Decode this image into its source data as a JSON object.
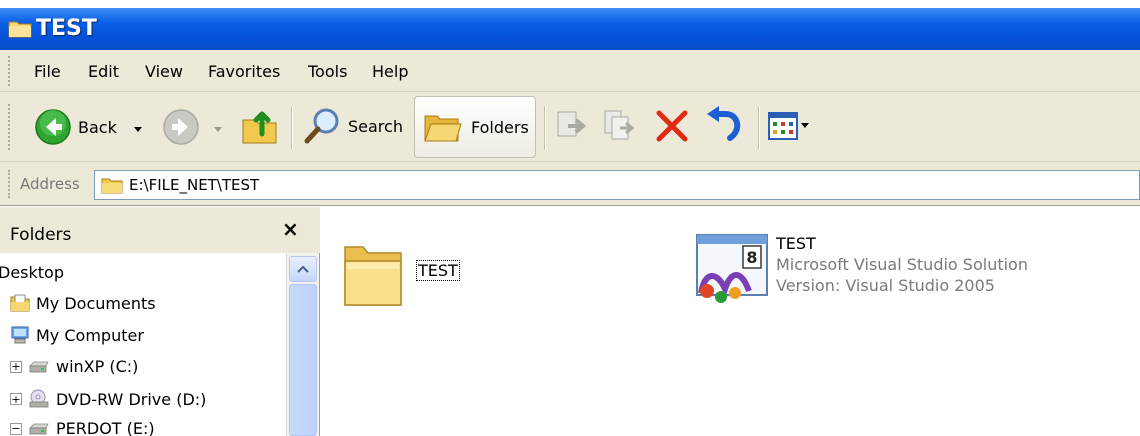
{
  "window": {
    "title": "TEST"
  },
  "menu": [
    "File",
    "Edit",
    "View",
    "Favorites",
    "Tools",
    "Help"
  ],
  "toolbar": {
    "back_label": "Back",
    "search_label": "Search",
    "folders_label": "Folders"
  },
  "address": {
    "label": "Address",
    "value": "E:\\FILE_NET\\TEST"
  },
  "folders_pane": {
    "title": "Folders",
    "close_glyph": "×",
    "tree": [
      {
        "label": "Desktop",
        "icon": "desktop-icon"
      },
      {
        "label": "My Documents",
        "icon": "my-documents-icon"
      },
      {
        "label": "My Computer",
        "icon": "my-computer-icon"
      },
      {
        "label": "winXP (C:)",
        "icon": "hard-drive-icon",
        "expander": "+"
      },
      {
        "label": "DVD-RW Drive (D:)",
        "icon": "dvd-drive-icon",
        "expander": "+"
      },
      {
        "label": "PERDOT (E:)",
        "icon": "hard-drive-icon",
        "expander": "−"
      }
    ]
  },
  "content": {
    "items": [
      {
        "name": "TEST",
        "type": "folder",
        "icon": "folder-icon"
      },
      {
        "name": "TEST",
        "type": "solution",
        "icon": "visual-studio-solution-icon",
        "lines": [
          "Microsoft Visual Studio Solution",
          "Version: Visual Studio 2005"
        ]
      }
    ]
  },
  "colors": {
    "title_bar": "#0a5fe6",
    "chrome": "#ece9d8",
    "delete_red": "#e02a12"
  }
}
